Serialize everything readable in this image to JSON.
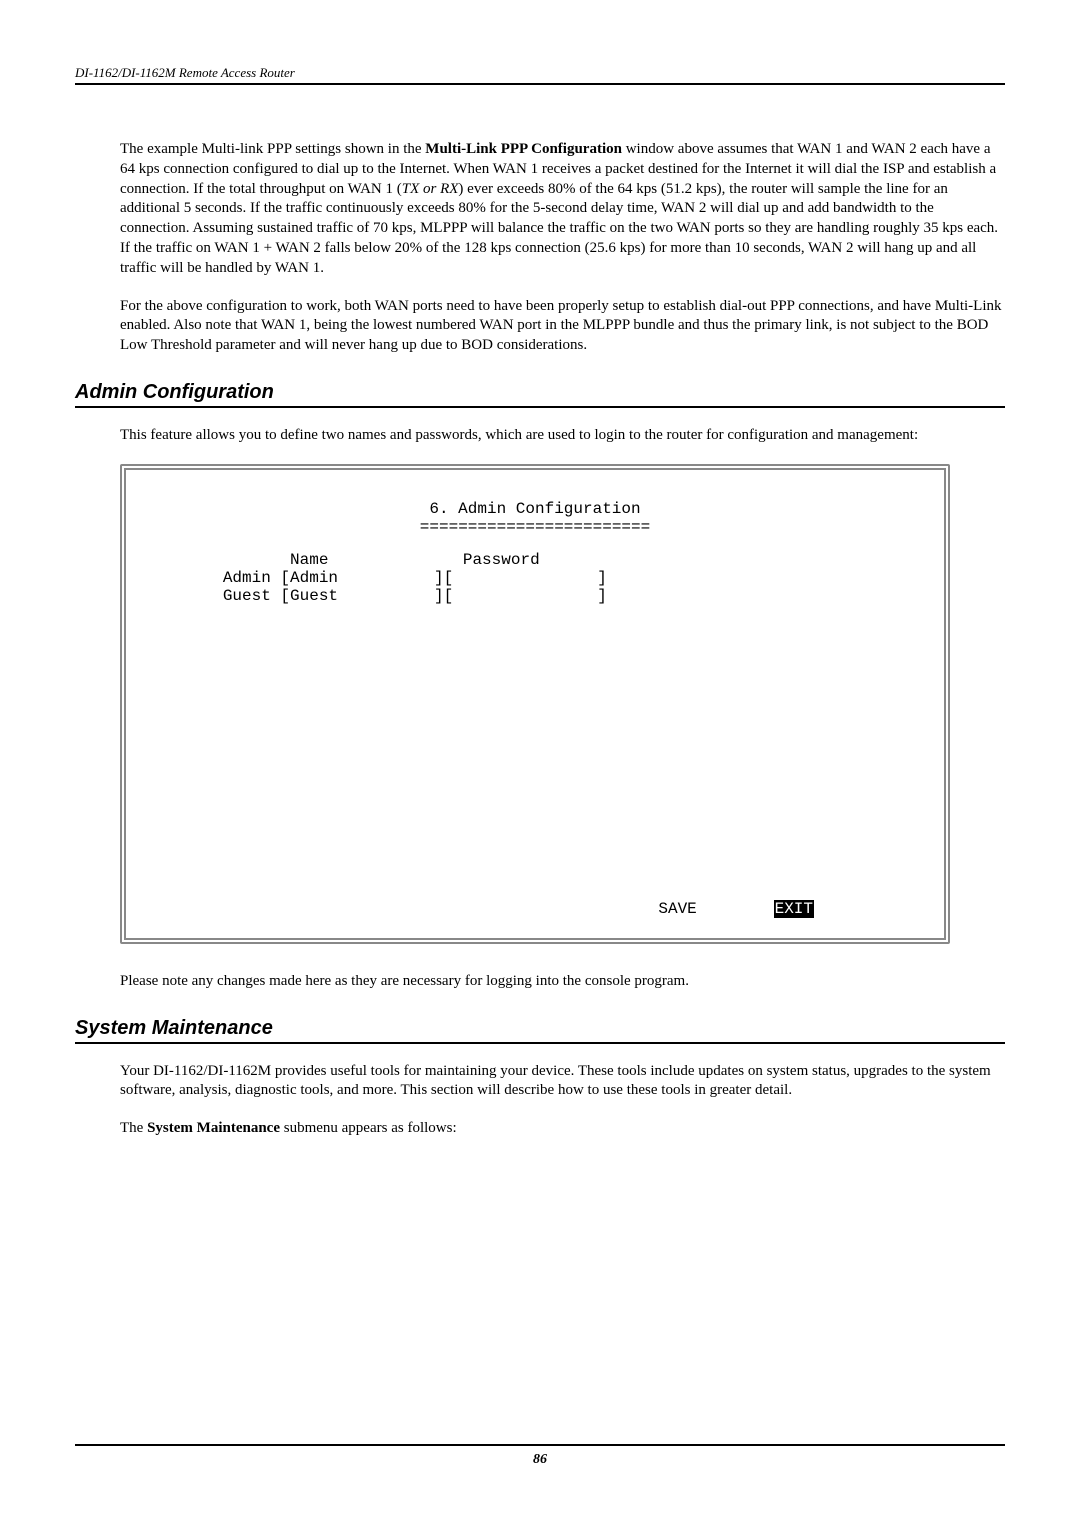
{
  "header": {
    "title": "DI-1162/DI-1162M Remote Access Router"
  },
  "para1": {
    "seg1": "The example Multi-link PPP settings shown in the ",
    "bold1": "Multi-Link PPP Configuration",
    "seg2": " window above assumes that WAN 1 and WAN 2 each have a 64 kps connection configured to dial up to the Internet. When WAN 1 receives a packet destined for the Internet it will dial the ISP and establish a connection. If the total throughput on WAN 1 (",
    "ital1": "TX or RX",
    "seg3": ") ever exceeds 80% of the 64 kps (51.2 kps), the router will sample the line for an additional 5 seconds. If the traffic continuously exceeds 80% for the 5-second delay time, WAN 2 will dial up and add bandwidth to the connection. Assuming sustained traffic of 70 kps, MLPPP will balance the traffic on the two WAN ports so they are handling roughly 35 kps each. If the traffic on WAN 1 + WAN 2 falls below 20% of the 128 kps connection (25.6 kps) for more than 10 seconds, WAN 2 will hang up and all traffic will be handled by WAN 1."
  },
  "para2": "For the above configuration to work, both WAN ports need to have been properly setup to establish dial-out PPP connections, and have Multi-Link enabled. Also note that WAN 1, being the lowest numbered WAN port in the MLPPP bundle and thus the primary link, is not subject to the BOD Low Threshold parameter and will never hang up due to BOD considerations.",
  "heading1": "Admin Configuration",
  "para3": "This feature allows you to define two names and passwords, which are used to login to the router for configuration and management:",
  "terminal": {
    "title": "6. Admin Configuration",
    "divider": "========================",
    "header": "               Name              Password",
    "line1": "        Admin [Admin          ][               ]",
    "line2": "        Guest [Guest          ][               ]",
    "save": "SAVE",
    "exit": "EXIT"
  },
  "para4": "Please note any changes made here as they are necessary for logging into the console program.",
  "heading2": "System Maintenance",
  "para5": "Your DI-1162/DI-1162M provides useful tools for maintaining your device. These tools include updates on system status, upgrades to the system software, analysis, diagnostic tools, and more. This section will describe how to use these tools in greater detail.",
  "para6": {
    "seg1": "The ",
    "bold1": "System Maintenance",
    "seg2": " submenu appears as follows:"
  },
  "footer": {
    "page": "86"
  }
}
